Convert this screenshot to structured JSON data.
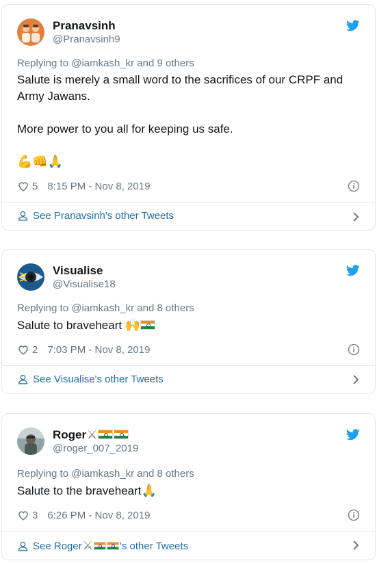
{
  "tweets": [
    {
      "display_name": "Pranavsinh",
      "handle": "@Pranavsinh9",
      "replying_prefix": "Replying to ",
      "replying_mention": "@iamkash_kr",
      "replying_suffix": " and 9 others",
      "text_line1": "Salute is merely a small word to the sacrifices of our CRPF and",
      "text_line2": "Army Jawans.",
      "text_line3": "More power to you all for keeping us safe.",
      "emojis": "💪👊🙏",
      "likes": "5",
      "timestamp": "8:15 PM - Nov 8, 2019",
      "see_more": "See Pranavsinh's other Tweets"
    },
    {
      "display_name": "Visualise",
      "handle": "@Visualise18",
      "replying_prefix": "Replying to ",
      "replying_mention": "@iamkash_kr",
      "replying_suffix": " and 8 others",
      "text": "Salute to braveheart",
      "emoji": "🙌",
      "likes": "2",
      "timestamp": "7:03 PM - Nov 8, 2019",
      "see_more": "See Visualise's other Tweets"
    },
    {
      "display_name": "Roger",
      "handle": "@roger_007_2019",
      "replying_prefix": "Replying to ",
      "replying_mention": "@iamkash_kr",
      "replying_suffix": " and 8 others",
      "text": "Salute to the braveheart",
      "emoji": "🙏",
      "likes": "3",
      "timestamp": "6:26 PM - Nov 8, 2019",
      "see_more_prefix": "See Roger",
      "see_more_suffix": "'s other Tweets"
    }
  ],
  "icons": {
    "like": "heart-icon",
    "info": "info-icon",
    "bird": "twitter-bird-icon",
    "user": "user-icon",
    "chevron": "chevron-right-icon",
    "swords": "crossed-swords-icon",
    "flag": "india-flag-icon"
  },
  "colors": {
    "twitter_blue": "#1da1f2",
    "link_blue": "#1b6ea8",
    "muted": "#657786",
    "border": "#e1e8ed"
  }
}
